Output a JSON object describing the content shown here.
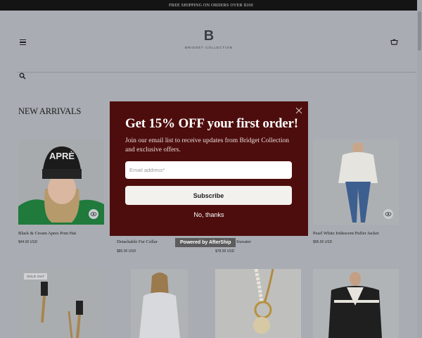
{
  "announcement": "FREE SHIPPING ON ORDERS OVER $100",
  "header": {
    "logo_mark": "B",
    "logo_text": "BRIDGET COLLECTION"
  },
  "section_title": "NEW ARRIVALS",
  "products_row1": [
    {
      "name": "Black & Cream Apres Pom Hat",
      "price": "$44.00 USD"
    },
    {
      "name": "Detachable Fur Collar",
      "price": "$80.00 USD"
    },
    {
      "name": "Sweater",
      "price": "$78.00 USD"
    },
    {
      "name": "Pearl White Iridescent Puffer Jacket",
      "price": "$95.00 USD"
    }
  ],
  "products_row2": [
    {
      "badge": "SOLD OUT"
    },
    {},
    {},
    {}
  ],
  "popup": {
    "title": "Get 15% OFF your first order!",
    "body": "Join our email list to receive updates from Bridget Collection and exclusive offers.",
    "email_placeholder": "Email address*",
    "subscribe_label": "Subscribe",
    "decline_label": "No, thanks",
    "powered_by": "Powered by AfterShip"
  },
  "icons": [
    "menu-icon",
    "bag-icon",
    "search-icon",
    "eye-icon",
    "close-icon"
  ],
  "colors": {
    "popup_bg": "#4e0d0d",
    "announcement_bg": "#141414",
    "page_overlay": "#a9adb3"
  }
}
